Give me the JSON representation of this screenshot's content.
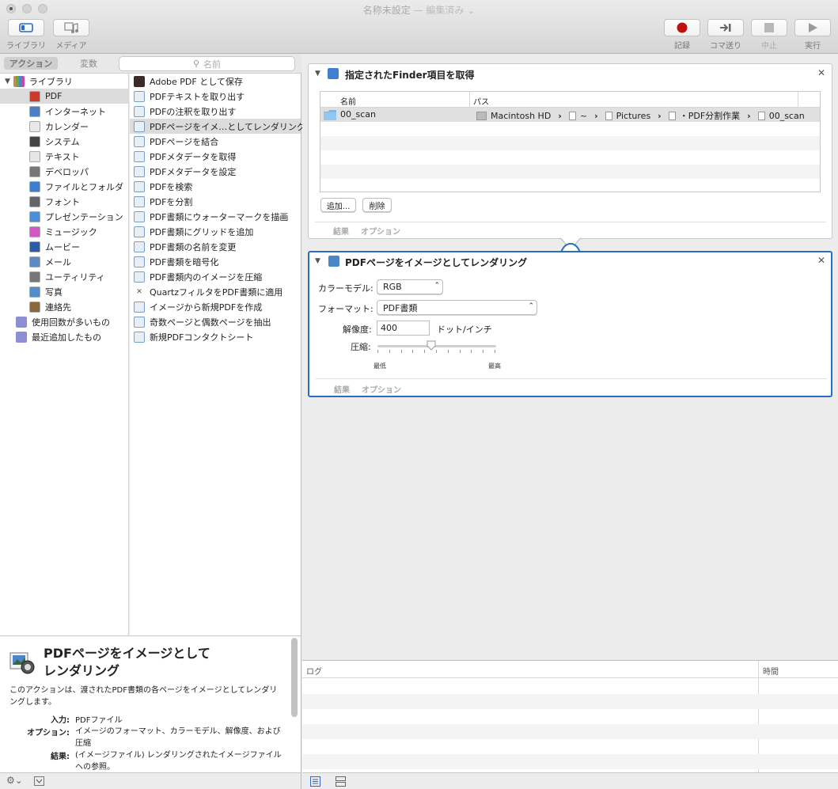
{
  "window": {
    "title": "名称未設定",
    "edited": "— 編集済み ⌄"
  },
  "toolbar": {
    "library_label": "ライブラリ",
    "media_label": "メディア",
    "record_label": "記録",
    "step_label": "コマ送り",
    "stop_label": "中止",
    "run_label": "実行"
  },
  "left": {
    "tab_actions": "アクション",
    "tab_variables": "変数",
    "search_placeholder": "名前"
  },
  "library": {
    "root": "ライブラリ",
    "items": [
      {
        "label": "PDF",
        "color": "#c83a2c"
      },
      {
        "label": "インターネット",
        "color": "#4a7ec8"
      },
      {
        "label": "カレンダー",
        "color": "#e8e8e8"
      },
      {
        "label": "システム",
        "color": "#444444"
      },
      {
        "label": "テキスト",
        "color": "#e6e6e6"
      },
      {
        "label": "デベロッパ",
        "color": "#777777"
      },
      {
        "label": "ファイルとフォルダ",
        "color": "#3b7fd4"
      },
      {
        "label": "フォント",
        "color": "#666666"
      },
      {
        "label": "プレゼンテーション",
        "color": "#4a8fd8"
      },
      {
        "label": "ミュージック",
        "color": "#d357c8"
      },
      {
        "label": "ムービー",
        "color": "#2b5aa6"
      },
      {
        "label": "メール",
        "color": "#5b8ac8"
      },
      {
        "label": "ユーティリティ",
        "color": "#777777"
      },
      {
        "label": "写真",
        "color": "#4f8fca"
      },
      {
        "label": "連絡先",
        "color": "#8a6a3a"
      }
    ],
    "smart": [
      {
        "label": "使用回数が多いもの"
      },
      {
        "label": "最近追加したもの"
      }
    ]
  },
  "actions": [
    "Adobe PDF として保存",
    "PDFテキストを取り出す",
    "PDFの注釈を取り出す",
    "PDFページをイメ…としてレンダリング",
    "PDFページを結合",
    "PDFメタデータを取得",
    "PDFメタデータを設定",
    "PDFを検索",
    "PDFを分割",
    "PDF書類にウォーターマークを描画",
    "PDF書類にグリッドを追加",
    "PDF書類の名前を変更",
    "PDF書類を暗号化",
    "PDF書類内のイメージを圧縮",
    "QuartzフィルタをPDF書類に適用",
    "イメージから新規PDFを作成",
    "奇数ページと偶数ページを抽出",
    "新規PDFコンタクトシート"
  ],
  "description": {
    "title_line1": "PDFページをイメージとして",
    "title_line2": "レンダリング",
    "body": "このアクションは、渡されたPDF書類の各ページをイメージとしてレンダリングします。",
    "input_label": "入力:",
    "input_value": "PDFファイル",
    "options_label": "オプション:",
    "options_value": "イメージのフォーマット、カラーモデル、解像度、および圧縮",
    "result_label": "結果:",
    "result_value": "(イメージファイル) レンダリングされたイメージファイルへの参照。"
  },
  "card1": {
    "title": "指定されたFinder項目を取得",
    "col_name": "名前",
    "col_path": "パス",
    "file_name": "00_scan",
    "path": [
      "Macintosh HD",
      "~",
      "Pictures",
      "・PDF分割作業",
      "00_scan"
    ],
    "add_button": "追加...",
    "remove_button": "削除",
    "tab_results": "結果",
    "tab_options": "オプション"
  },
  "card2": {
    "title": "PDFページをイメージとしてレンダリング",
    "color_model_label": "カラーモデル:",
    "color_model_value": "RGB",
    "format_label": "フォーマット:",
    "format_value": "PDF書類",
    "resolution_label": "解像度:",
    "resolution_value": "400",
    "resolution_unit": "ドット/インチ",
    "compression_label": "圧縮:",
    "compression_level": 0.45,
    "compression_min": "最低",
    "compression_max": "最高",
    "tab_results": "結果",
    "tab_options": "オプション"
  },
  "log": {
    "col_log": "ログ",
    "col_time": "時間"
  }
}
